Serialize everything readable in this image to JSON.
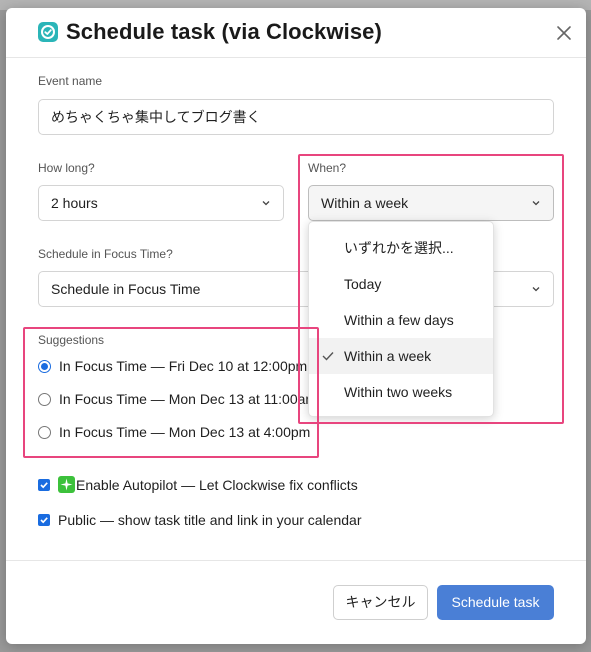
{
  "modal": {
    "title": "Schedule task (via Clockwise)",
    "logo_icon": "clockwise-logo-icon",
    "close_icon": "close-icon"
  },
  "event_name": {
    "label": "Event name",
    "value": "めちゃくちゃ集中してブログ書く"
  },
  "how_long": {
    "label": "How long?",
    "value": "2 hours"
  },
  "when": {
    "label": "When?",
    "value": "Within a week",
    "options": [
      {
        "label": "いずれかを選択...",
        "selected": false
      },
      {
        "label": "Today",
        "selected": false
      },
      {
        "label": "Within a few days",
        "selected": false
      },
      {
        "label": "Within a week",
        "selected": true
      },
      {
        "label": "Within two weeks",
        "selected": false
      }
    ]
  },
  "focus_time": {
    "label": "Schedule in Focus Time?",
    "value": "Schedule in Focus Time"
  },
  "suggestions": {
    "label": "Suggestions",
    "items": [
      {
        "label": "In Focus Time — Fri Dec 10 at 12:00pm",
        "checked": true
      },
      {
        "label": "In Focus Time — Mon Dec 13 at 11:00am",
        "checked": false
      },
      {
        "label": "In Focus Time — Mon Dec 13 at 4:00pm",
        "checked": false
      }
    ]
  },
  "options": {
    "autopilot": {
      "label": "Enable Autopilot — Let Clockwise fix conflicts",
      "checked": true,
      "icon": "sparkle-icon"
    },
    "public": {
      "label": "Public — show task title and link in your calendar",
      "checked": true
    }
  },
  "footer": {
    "cancel_label": "キャンセル",
    "submit_label": "Schedule task"
  },
  "colors": {
    "highlight": "#e8457e",
    "primary": "#4a7fd6",
    "accent_blue": "#1a6ce0"
  }
}
